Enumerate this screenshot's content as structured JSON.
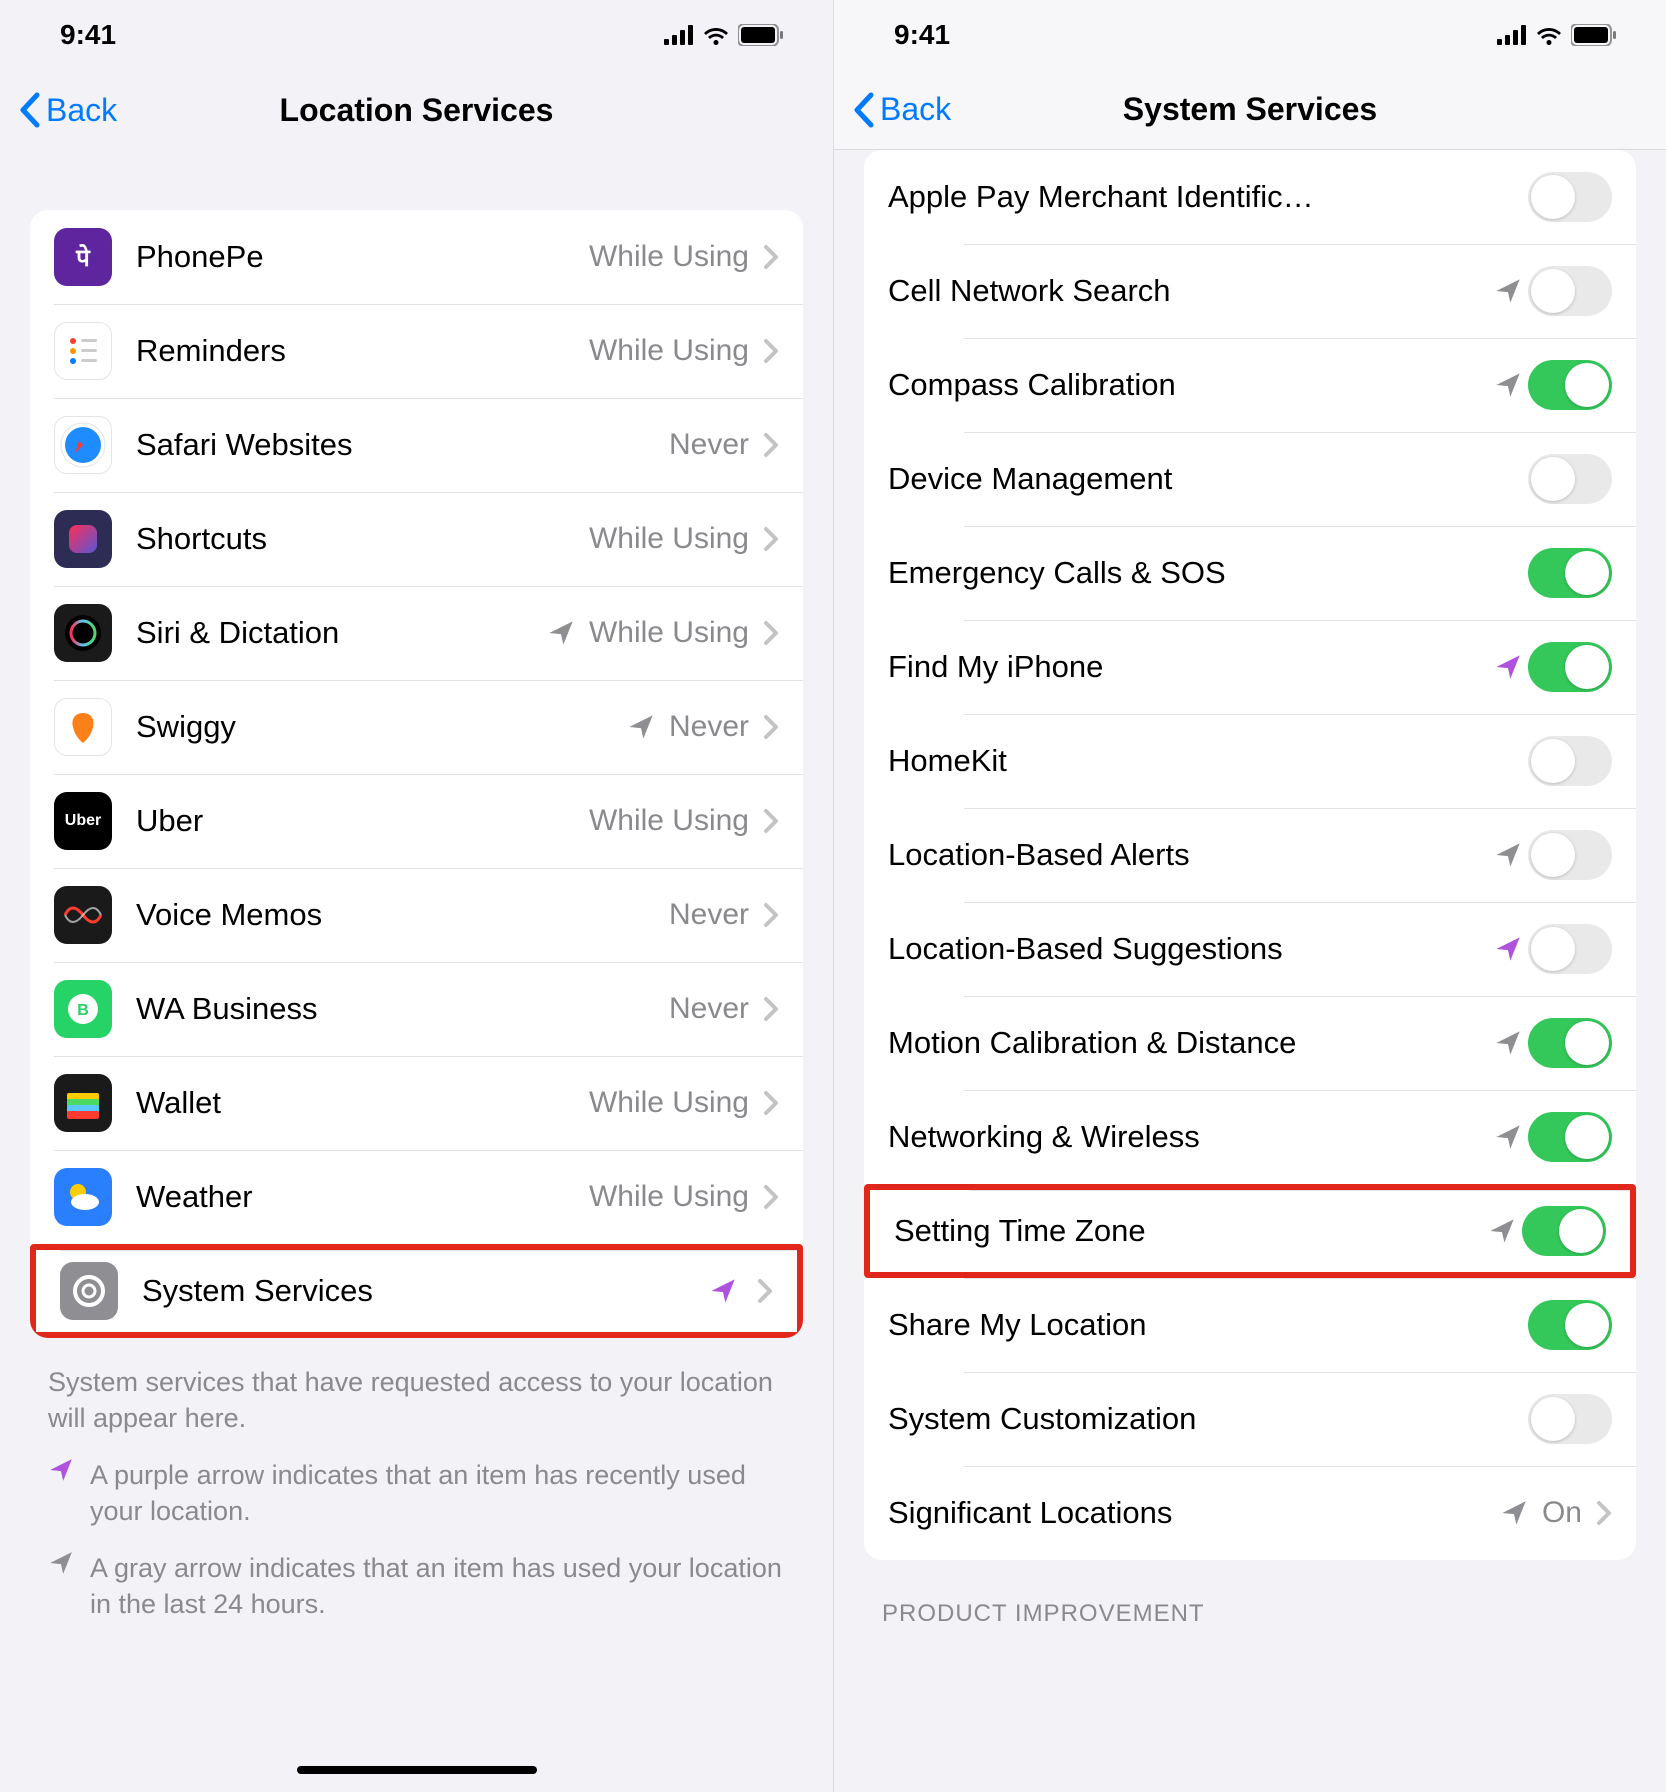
{
  "status": {
    "time": "9:41"
  },
  "left": {
    "nav": {
      "back": "Back",
      "title": "Location Services"
    },
    "apps": [
      {
        "name": "PhonePe",
        "status": "While Using",
        "icon_bg": "#5f259f",
        "icon_text": "पे",
        "arrow": null
      },
      {
        "name": "Reminders",
        "status": "While Using",
        "icon_bg": "#ffffff",
        "icon_text": "",
        "arrow": null,
        "icon_variant": "reminders"
      },
      {
        "name": "Safari Websites",
        "status": "Never",
        "icon_bg": "#ffffff",
        "icon_text": "",
        "arrow": null,
        "icon_variant": "safari"
      },
      {
        "name": "Shortcuts",
        "status": "While Using",
        "icon_bg": "#2c2c54",
        "icon_text": "",
        "arrow": null,
        "icon_variant": "shortcuts"
      },
      {
        "name": "Siri & Dictation",
        "status": "While Using",
        "icon_bg": "#1a1a1a",
        "icon_text": "",
        "arrow": "gray",
        "icon_variant": "siri"
      },
      {
        "name": "Swiggy",
        "status": "Never",
        "icon_bg": "#ffffff",
        "icon_text": "",
        "arrow": "gray",
        "icon_variant": "swiggy"
      },
      {
        "name": "Uber",
        "status": "While Using",
        "icon_bg": "#000000",
        "icon_text": "Uber",
        "arrow": null
      },
      {
        "name": "Voice Memos",
        "status": "Never",
        "icon_bg": "#1a1a1a",
        "icon_text": "",
        "arrow": null,
        "icon_variant": "voicememos"
      },
      {
        "name": "WA Business",
        "status": "Never",
        "icon_bg": "#25d366",
        "icon_text": "",
        "arrow": null,
        "icon_variant": "whatsapp"
      },
      {
        "name": "Wallet",
        "status": "While Using",
        "icon_bg": "#1a1a1a",
        "icon_text": "",
        "arrow": null,
        "icon_variant": "wallet"
      },
      {
        "name": "Weather",
        "status": "While Using",
        "icon_bg": "#2a7fff",
        "icon_text": "",
        "arrow": null,
        "icon_variant": "weather"
      },
      {
        "name": "System Services",
        "status": "",
        "icon_bg": "#8e8e93",
        "icon_text": "",
        "arrow": "purple",
        "icon_variant": "gear",
        "highlight": true
      }
    ],
    "footer": "System services that have requested access to your location will appear here.",
    "legend_purple": "A purple arrow indicates that an item has recently used your location.",
    "legend_gray": "A gray arrow indicates that an item has used your location in the last 24 hours."
  },
  "right": {
    "nav": {
      "back": "Back",
      "title": "System Services"
    },
    "services": [
      {
        "name": "Apple Pay Merchant Identific…",
        "arrow": null,
        "on": false
      },
      {
        "name": "Cell Network Search",
        "arrow": "gray",
        "on": false
      },
      {
        "name": "Compass Calibration",
        "arrow": "gray",
        "on": true
      },
      {
        "name": "Device Management",
        "arrow": null,
        "on": false
      },
      {
        "name": "Emergency Calls & SOS",
        "arrow": null,
        "on": true
      },
      {
        "name": "Find My iPhone",
        "arrow": "purple",
        "on": true
      },
      {
        "name": "HomeKit",
        "arrow": null,
        "on": false
      },
      {
        "name": "Location-Based Alerts",
        "arrow": "gray",
        "on": false
      },
      {
        "name": "Location-Based Suggestions",
        "arrow": "purple",
        "on": false
      },
      {
        "name": "Motion Calibration & Distance",
        "arrow": "gray",
        "on": true
      },
      {
        "name": "Networking & Wireless",
        "arrow": "gray",
        "on": true
      },
      {
        "name": "Setting Time Zone",
        "arrow": "gray",
        "on": true,
        "highlight": true
      },
      {
        "name": "Share My Location",
        "arrow": null,
        "on": true
      },
      {
        "name": "System Customization",
        "arrow": null,
        "on": false
      },
      {
        "name": "Significant Locations",
        "arrow": "gray",
        "status": "On",
        "nav": true
      }
    ],
    "section_footer": "PRODUCT IMPROVEMENT"
  }
}
